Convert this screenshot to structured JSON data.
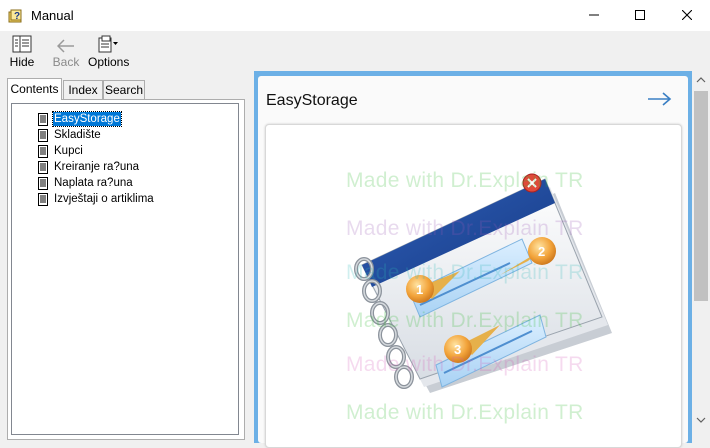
{
  "window": {
    "title": "Manual"
  },
  "toolbar": {
    "hide_label": "Hide",
    "back_label": "Back",
    "options_label": "Options"
  },
  "tabs": [
    {
      "label": "Contents",
      "active": true
    },
    {
      "label": "Index",
      "active": false
    },
    {
      "label": "Search",
      "active": false
    }
  ],
  "tree": {
    "items": [
      {
        "label": "EasyStorage",
        "selected": true
      },
      {
        "label": "Skladište"
      },
      {
        "label": "Kupci"
      },
      {
        "label": "Kreiranje ra?una"
      },
      {
        "label": "Naplata ra?una"
      },
      {
        "label": "Izvještaji o artiklima"
      }
    ]
  },
  "content": {
    "title": "EasyStorage",
    "next_icon": "right-arrow-icon",
    "watermark": "Made with Dr.Explain TR",
    "image_icon": "notebook-illustration"
  },
  "colors": {
    "accent": "#0078d7",
    "pane_border": "#6cb0e6",
    "arrow": "#3a7fc4"
  }
}
